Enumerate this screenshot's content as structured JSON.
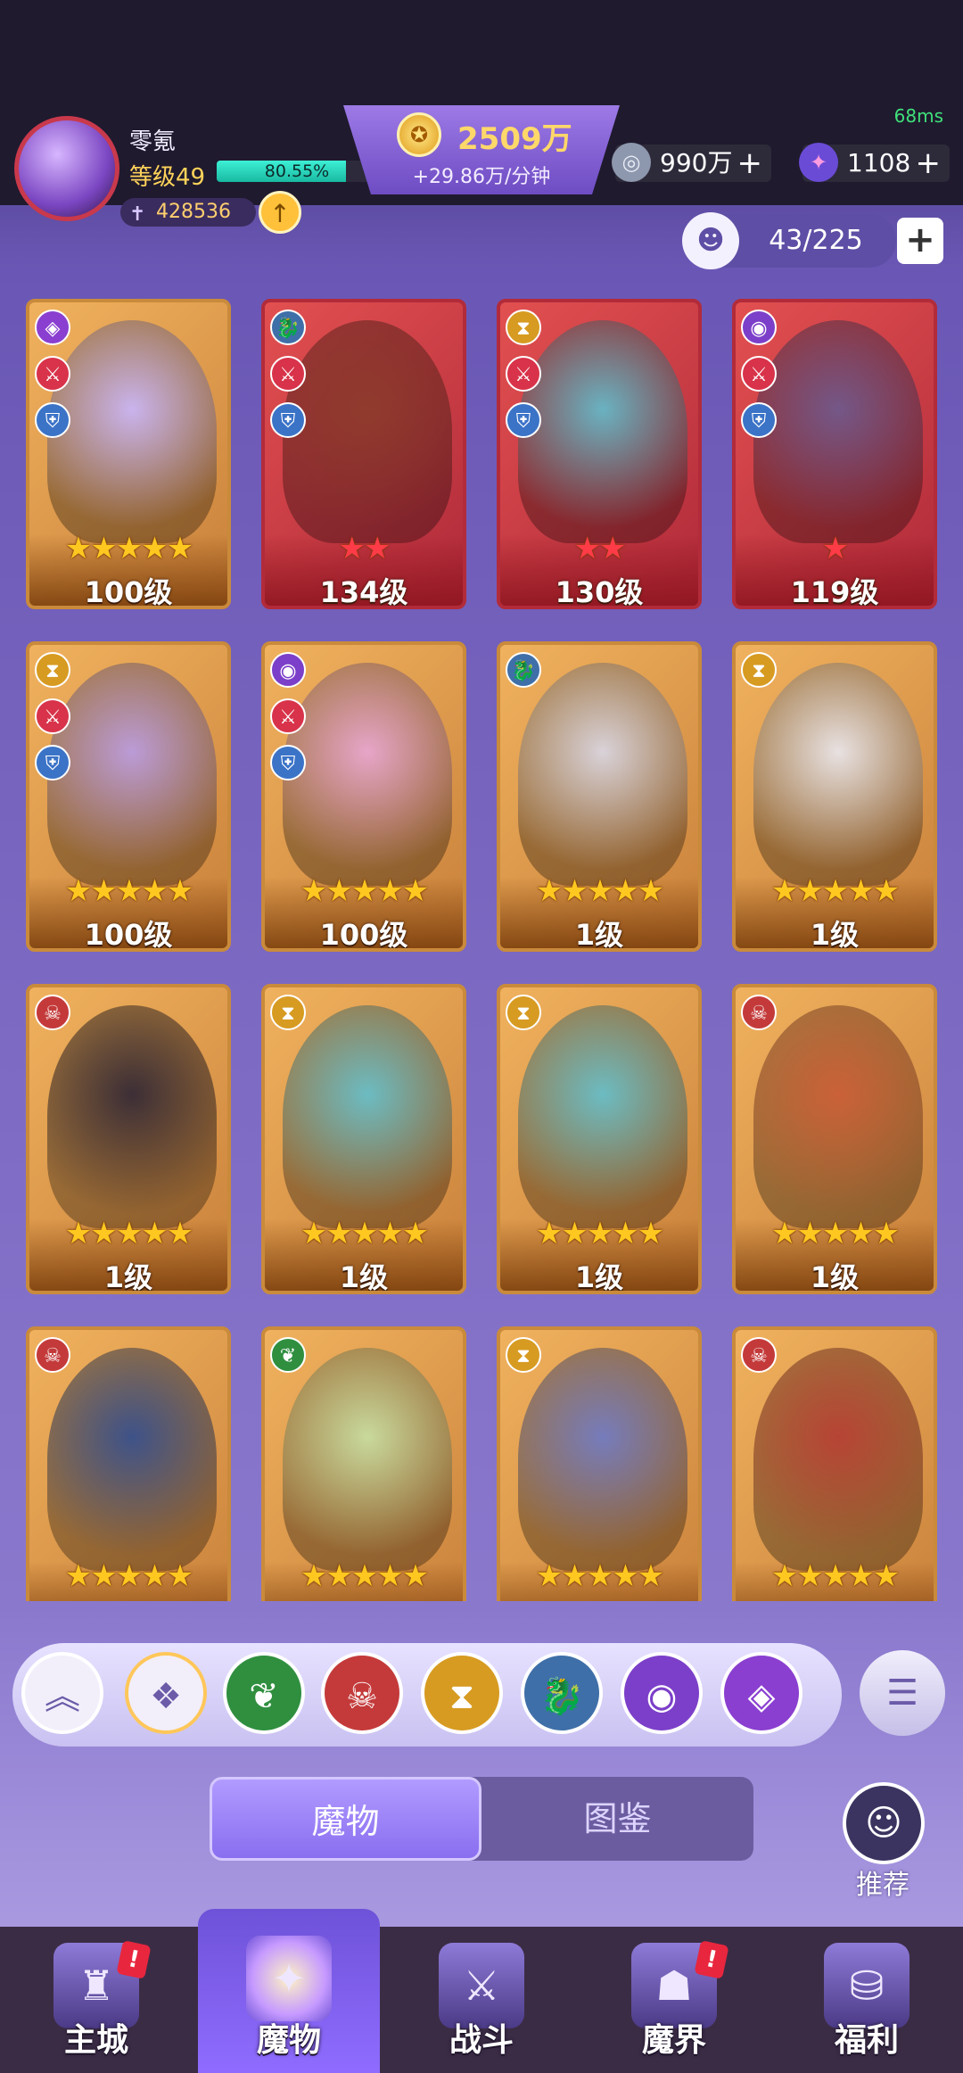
{
  "status": {
    "ping": "68ms"
  },
  "player": {
    "name": "零氪",
    "level_label": "等级49",
    "xp_percent_label": "80.55%",
    "xp_fraction": 0.8055,
    "power": "428536"
  },
  "currency": {
    "gold": "2509万",
    "gold_rate": "+29.86万/分钟",
    "silver": "990万",
    "gems": "1108"
  },
  "collection": {
    "count": "43/225"
  },
  "monsters": [
    {
      "level": "100级",
      "stars": 5,
      "star_color": "gold",
      "frame": "gold",
      "faction": "storm",
      "badges": [
        "attack",
        "defense"
      ],
      "art_color": "#c7b6ff"
    },
    {
      "level": "134级",
      "stars": 2,
      "star_color": "red",
      "frame": "red",
      "faction": "dragon",
      "badges": [
        "attack",
        "defense"
      ],
      "art_color": "#8a3a2a"
    },
    {
      "level": "130级",
      "stars": 2,
      "star_color": "red",
      "frame": "red",
      "faction": "hourglass",
      "badges": [
        "attack",
        "defense"
      ],
      "art_color": "#5fbfcf"
    },
    {
      "level": "119级",
      "stars": 1,
      "star_color": "red",
      "frame": "red",
      "faction": "eye",
      "badges": [
        "attack",
        "defense"
      ],
      "art_color": "#6a5a8f"
    },
    {
      "level": "100级",
      "stars": 5,
      "star_color": "gold",
      "frame": "gold",
      "faction": "hourglass",
      "badges": [
        "attack",
        "defense"
      ],
      "art_color": "#b79be6"
    },
    {
      "level": "100级",
      "stars": 5,
      "star_color": "gold",
      "frame": "gold",
      "faction": "eye",
      "badges": [
        "attack",
        "defense"
      ],
      "art_color": "#e7a6d6"
    },
    {
      "level": "1级",
      "stars": 5,
      "star_color": "gold",
      "frame": "gold",
      "faction": "dragon",
      "badges": [],
      "art_color": "#d8d8e8"
    },
    {
      "level": "1级",
      "stars": 5,
      "star_color": "gold",
      "frame": "gold",
      "faction": "hourglass",
      "badges": [],
      "art_color": "#e9e9f2"
    },
    {
      "level": "1级",
      "stars": 5,
      "star_color": "gold",
      "frame": "gold",
      "faction": "demon",
      "badges": [],
      "art_color": "#2a2233"
    },
    {
      "level": "1级",
      "stars": 5,
      "star_color": "gold",
      "frame": "gold",
      "faction": "hourglass",
      "badges": [],
      "art_color": "#5fbfcf"
    },
    {
      "level": "1级",
      "stars": 5,
      "star_color": "gold",
      "frame": "gold",
      "faction": "hourglass",
      "badges": [],
      "art_color": "#5fbfcf"
    },
    {
      "level": "1级",
      "stars": 5,
      "star_color": "gold",
      "frame": "gold",
      "faction": "demon",
      "badges": [],
      "art_color": "#c85a36"
    },
    {
      "level": "",
      "stars": 5,
      "star_color": "gold",
      "frame": "gold",
      "faction": "demon",
      "badges": [],
      "art_color": "#2c4a8f"
    },
    {
      "level": "",
      "stars": 5,
      "star_color": "gold",
      "frame": "gold",
      "faction": "nature",
      "badges": [],
      "art_color": "#c6e0a5"
    },
    {
      "level": "",
      "stars": 5,
      "star_color": "gold",
      "frame": "gold",
      "faction": "hourglass",
      "badges": [],
      "art_color": "#6a78c8"
    },
    {
      "level": "",
      "stars": 5,
      "star_color": "gold",
      "frame": "gold",
      "faction": "demon",
      "badges": [],
      "art_color": "#b23a32"
    }
  ],
  "faction_icons": {
    "storm": {
      "glyph": "◈",
      "color": "#8a3fd0"
    },
    "dragon": {
      "glyph": "🐉",
      "color": "#3f6fa8"
    },
    "hourglass": {
      "glyph": "⧗",
      "color": "#d79b22"
    },
    "eye": {
      "glyph": "◉",
      "color": "#7c3fc9"
    },
    "demon": {
      "glyph": "☠",
      "color": "#c43a3a"
    },
    "nature": {
      "glyph": "❦",
      "color": "#2f8f3f"
    },
    "attack": {
      "glyph": "⚔",
      "color": "#d8334a"
    },
    "defense": {
      "glyph": "⛨",
      "color": "#3b73c7"
    }
  },
  "filters": [
    {
      "name": "collapse",
      "glyph": "︽",
      "color": "#f2effb"
    },
    {
      "name": "all",
      "glyph": "❖",
      "color": "#f2effb"
    },
    {
      "name": "nature",
      "glyph": "❦",
      "color": "#2f8f3f"
    },
    {
      "name": "demon",
      "glyph": "☠",
      "color": "#c43a3a"
    },
    {
      "name": "hourglass",
      "glyph": "⧗",
      "color": "#d79b22"
    },
    {
      "name": "dragon",
      "glyph": "🐉",
      "color": "#3f6fa8"
    },
    {
      "name": "eye",
      "glyph": "◉",
      "color": "#7c3fc9"
    },
    {
      "name": "storm",
      "glyph": "◈",
      "color": "#8a3fd0"
    }
  ],
  "tabs": {
    "monsters": "魔物",
    "codex": "图鉴"
  },
  "recommend_label": "推荐",
  "nav": [
    {
      "label": "主城",
      "icon": "castle",
      "glyph": "♜",
      "alert": "!"
    },
    {
      "label": "魔物",
      "icon": "monster",
      "glyph": "✦",
      "alert": ""
    },
    {
      "label": "战斗",
      "icon": "shield",
      "glyph": "⚔",
      "alert": ""
    },
    {
      "label": "魔界",
      "icon": "portal",
      "glyph": "☗",
      "alert": "!"
    },
    {
      "label": "福利",
      "icon": "chest",
      "glyph": "⛁",
      "alert": ""
    }
  ]
}
